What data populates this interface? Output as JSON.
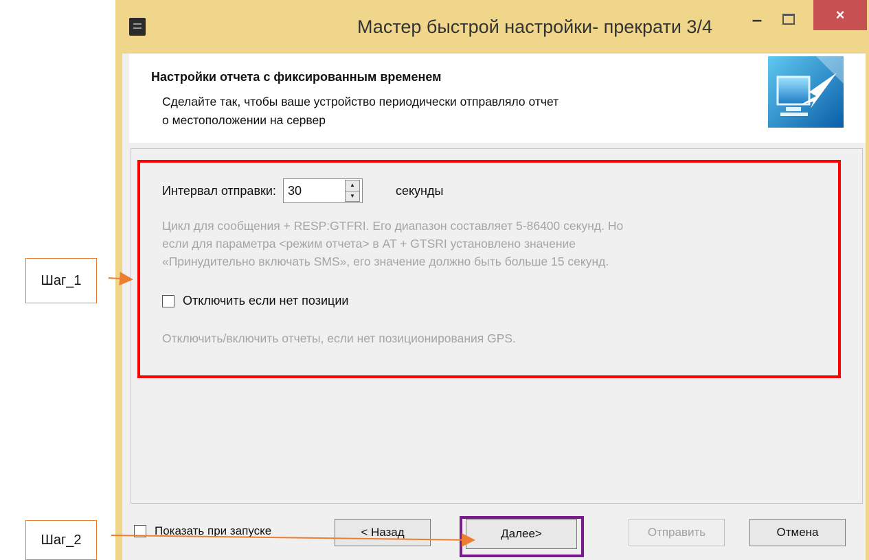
{
  "window": {
    "title": "Мастер быстрой настройки- прекрати 3/4",
    "minimize_symbol": "–",
    "close_symbol": "×",
    "icons": [
      "app-icon",
      "minimize-icon",
      "maximize-icon",
      "close-icon",
      "monitor-arrow-icon"
    ]
  },
  "header": {
    "title": "Настройки отчета с фиксированным временем",
    "description": "Сделайте так, чтобы ваше устройство периодически отправляло отчет\n о местоположении на сервер"
  },
  "settings": {
    "interval_label": "Интервал отправки:",
    "interval_value": "30",
    "interval_unit": "секунды",
    "interval_help": "Цикл для сообщения + RESP:GTFRI. Его диапазон составляет 5-86400 секунд. Но\nесли для параметра <режим отчета> в AT + GTSRI установлено значение\n«Принудительно включать SMS», его значение должно быть больше 15 секунд.",
    "disable_checkbox_label": "Отключить если нет позиции",
    "disable_checkbox_checked": false,
    "disable_help": "Отключить/включить отчеты, если нет позиционирования GPS."
  },
  "footer": {
    "show_on_start_label": "Показать при запуске",
    "show_on_start_checked": false,
    "back_label": "< Назад",
    "next_label": "Далее>",
    "send_label": "Отправить",
    "cancel_label": "Отмена"
  },
  "annotations": {
    "step1_label": "Шаг_1",
    "step2_label": "Шаг_2",
    "highlight_color": "#ff0000",
    "button_highlight_color": "#7a1a8c",
    "arrow_color": "#ed7d31"
  }
}
